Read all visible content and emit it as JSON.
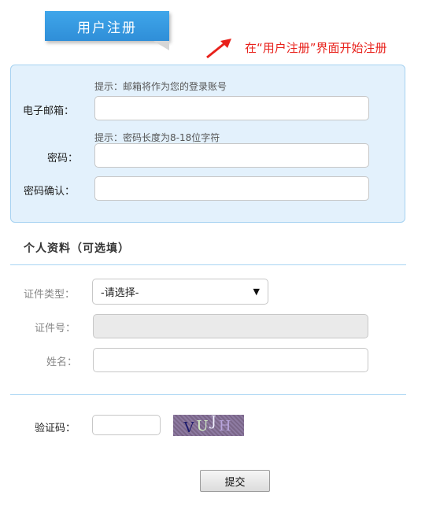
{
  "header": {
    "title": "用户注册",
    "annotation": "在“用户注册”界面开始注册"
  },
  "required": {
    "email": {
      "hint": "提示：邮箱将作为您的登录账号",
      "label": "电子邮箱：",
      "value": ""
    },
    "password": {
      "hint": "提示：密码长度为8-18位字符",
      "label": "密码：",
      "value": ""
    },
    "confirm": {
      "label": "密码确认：",
      "value": ""
    }
  },
  "optional": {
    "section_title": "个人资料（可选填）",
    "id_type": {
      "label": "证件类型：",
      "selected": "-请选择-"
    },
    "id_number": {
      "label": "证件号：",
      "value": ""
    },
    "name": {
      "label": "姓名：",
      "value": ""
    }
  },
  "captcha": {
    "label": "验证码：",
    "value": "",
    "image_chars": [
      "V",
      "U",
      "J",
      "H"
    ]
  },
  "submit": {
    "label": "提交"
  },
  "colors": {
    "title_bg": "#2f8ed8",
    "annotation": "#e8211b",
    "panel_bg": "#e3f1fc",
    "panel_border": "#a6d2f1"
  }
}
